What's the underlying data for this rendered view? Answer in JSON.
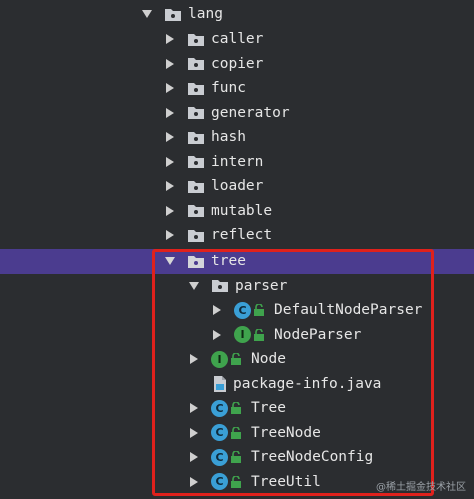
{
  "tree": {
    "items": [
      {
        "label": "lang",
        "kind": "folder",
        "expanded": true,
        "arrow": "down"
      },
      {
        "label": "caller",
        "kind": "folder",
        "arrow": "right"
      },
      {
        "label": "copier",
        "kind": "folder",
        "arrow": "right"
      },
      {
        "label": "func",
        "kind": "folder",
        "arrow": "right"
      },
      {
        "label": "generator",
        "kind": "folder",
        "arrow": "right"
      },
      {
        "label": "hash",
        "kind": "folder",
        "arrow": "right"
      },
      {
        "label": "intern",
        "kind": "folder",
        "arrow": "right"
      },
      {
        "label": "loader",
        "kind": "folder",
        "arrow": "right"
      },
      {
        "label": "mutable",
        "kind": "folder",
        "arrow": "right"
      },
      {
        "label": "reflect",
        "kind": "folder",
        "arrow": "right"
      },
      {
        "label": "tree",
        "kind": "folder",
        "arrow": "down",
        "selected": true
      },
      {
        "label": "parser",
        "kind": "folder",
        "arrow": "down"
      },
      {
        "label": "DefaultNodeParser",
        "kind": "class",
        "badge": "C",
        "arrow": "right"
      },
      {
        "label": "NodeParser",
        "kind": "interface",
        "badge": "I",
        "arrow": "right"
      },
      {
        "label": "Node",
        "kind": "interface",
        "badge": "I",
        "arrow": "right"
      },
      {
        "label": "package-info.java",
        "kind": "java-file",
        "arrow": "none"
      },
      {
        "label": "Tree",
        "kind": "class",
        "badge": "C",
        "arrow": "right"
      },
      {
        "label": "TreeNode",
        "kind": "class",
        "badge": "C",
        "arrow": "right"
      },
      {
        "label": "TreeNodeConfig",
        "kind": "class",
        "badge": "C",
        "arrow": "right"
      },
      {
        "label": "TreeUtil",
        "kind": "class",
        "badge": "C",
        "arrow": "right"
      }
    ]
  },
  "watermark": "@稀土掘金技术社区",
  "colors": {
    "background": "#2b2d30",
    "selection": "#4b3c8f",
    "highlight_border": "#e0211c",
    "class_badge": "#3a9fd6",
    "interface_badge": "#3fa34d",
    "lock": "#3fa34d"
  }
}
